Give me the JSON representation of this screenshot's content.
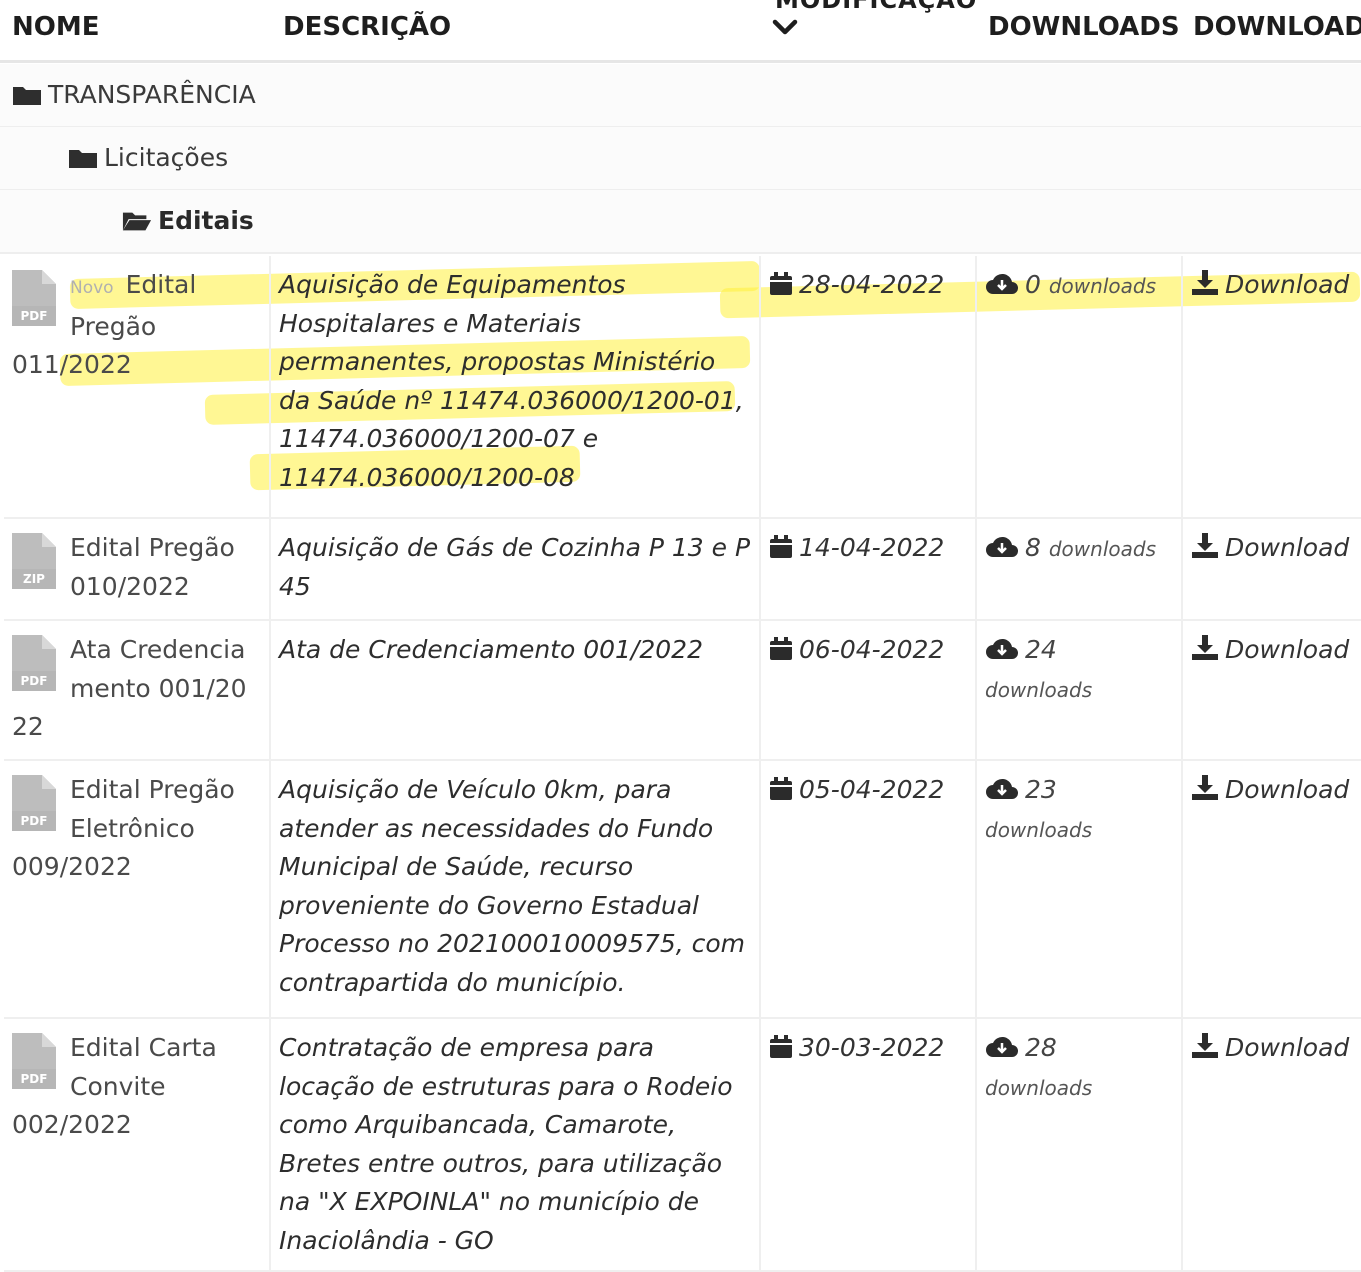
{
  "header": {
    "cut_label": "MODIFICAÇÃO",
    "col_nome": "NOME",
    "col_descricao": "DESCRIÇÃO",
    "col_downloads": "DOWNLOADS",
    "col_download": "DOWNLOAD"
  },
  "breadcrumb": {
    "level1": "TRANSPARÊNCIA",
    "level2": "Licitações",
    "level3": "Editais"
  },
  "files": [
    {
      "type": "PDF",
      "new_tag": "Novo",
      "name": "Edital Pregão 011/2022",
      "description": "Aquisição de Equipamentos Hospitalares e Materiais permanentes, propostas Ministério da Saúde nº 11474.036000/1200-01, 11474.036000/1200-07 e 11474.036000/1200-08",
      "date": "28-04-2022",
      "downloads_count": "0",
      "downloads_word": "downloads",
      "download_label": "Download"
    },
    {
      "type": "ZIP",
      "new_tag": "",
      "name": "Edital Pregão 010/2022",
      "description": "Aquisição de Gás de Cozinha P 13 e P 45",
      "date": "14-04-2022",
      "downloads_count": "8",
      "downloads_word": "downloads",
      "download_label": "Download"
    },
    {
      "type": "PDF",
      "new_tag": "",
      "name": "Ata Credenciamento 001/2022",
      "description": "Ata de Credenciamento 001/2022",
      "date": "06-04-2022",
      "downloads_count": "24",
      "downloads_word": "downloads",
      "download_label": "Download"
    },
    {
      "type": "PDF",
      "new_tag": "",
      "name": "Edital Pregão Eletrônico 009/2022",
      "description": "Aquisição de Veículo 0km, para atender as necessidades do Fundo Municipal de Saúde, recurso proveniente do Governo Estadual Processo no 202100010009575, com contrapartida do município.",
      "date": "05-04-2022",
      "downloads_count": "23",
      "downloads_word": "downloads",
      "download_label": "Download"
    },
    {
      "type": "PDF",
      "new_tag": "",
      "name": "Edital Carta Convite 002/2022",
      "description": "Contratação de empresa para locação de estruturas para o Rodeio como Arquibancada, Camarote, Bretes entre outros, para utilização na \"X EXPOINLA\" no município de Inaciolândia - GO",
      "date": "30-03-2022",
      "downloads_count": "28",
      "downloads_word": "downloads",
      "download_label": "Download"
    }
  ],
  "colors": {
    "highlighter": "#fff03c",
    "icon_gray": "#b6b6b6",
    "text_dark": "#1e1e1e"
  }
}
